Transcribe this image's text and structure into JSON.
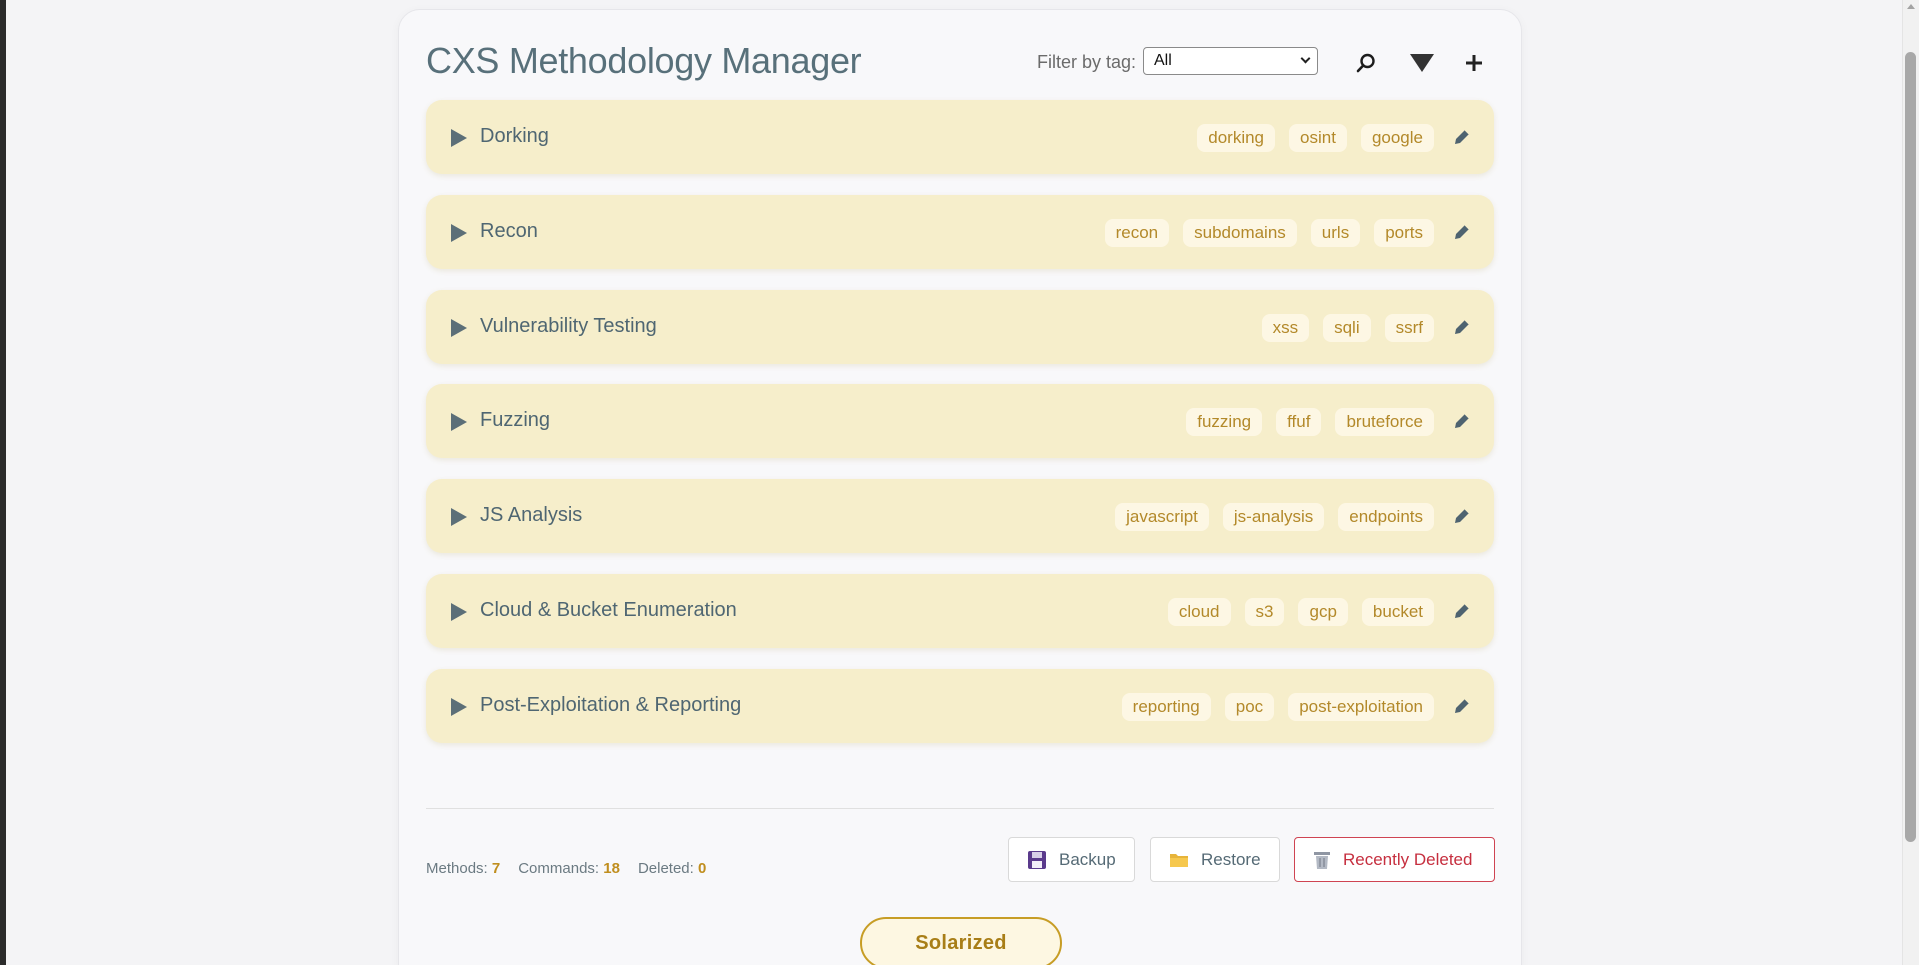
{
  "app": {
    "title": "CXS Methodology Manager"
  },
  "filter": {
    "label": "Filter by tag:",
    "selected": "All"
  },
  "toolbar": {
    "search_icon": "search-icon",
    "filter_icon": "filter-icon",
    "add_icon": "plus-icon"
  },
  "methods": [
    {
      "name": "Dorking",
      "tags": [
        "dorking",
        "osint",
        "google"
      ]
    },
    {
      "name": "Recon",
      "tags": [
        "recon",
        "subdomains",
        "urls",
        "ports"
      ]
    },
    {
      "name": "Vulnerability Testing",
      "tags": [
        "xss",
        "sqli",
        "ssrf"
      ]
    },
    {
      "name": "Fuzzing",
      "tags": [
        "fuzzing",
        "ffuf",
        "bruteforce"
      ]
    },
    {
      "name": "JS Analysis",
      "tags": [
        "javascript",
        "js-analysis",
        "endpoints"
      ]
    },
    {
      "name": "Cloud & Bucket Enumeration",
      "tags": [
        "cloud",
        "s3",
        "gcp",
        "bucket"
      ]
    },
    {
      "name": "Post-Exploitation & Reporting",
      "tags": [
        "reporting",
        "poc",
        "post-exploitation"
      ]
    }
  ],
  "stats": {
    "methods_label": "Methods:",
    "methods_count": "7",
    "commands_label": "Commands:",
    "commands_count": "18",
    "deleted_label": "Deleted:",
    "deleted_count": "0"
  },
  "actions": {
    "backup_label": "Backup",
    "restore_label": "Restore",
    "recently_deleted_label": "Recently Deleted"
  },
  "theme": {
    "label": "Solarized"
  },
  "colors": {
    "card_bg": "#f6eecb",
    "tag_text": "#b3892a",
    "title_text": "#58707a",
    "accent": "#c79d25",
    "danger": "#c62f3f"
  }
}
